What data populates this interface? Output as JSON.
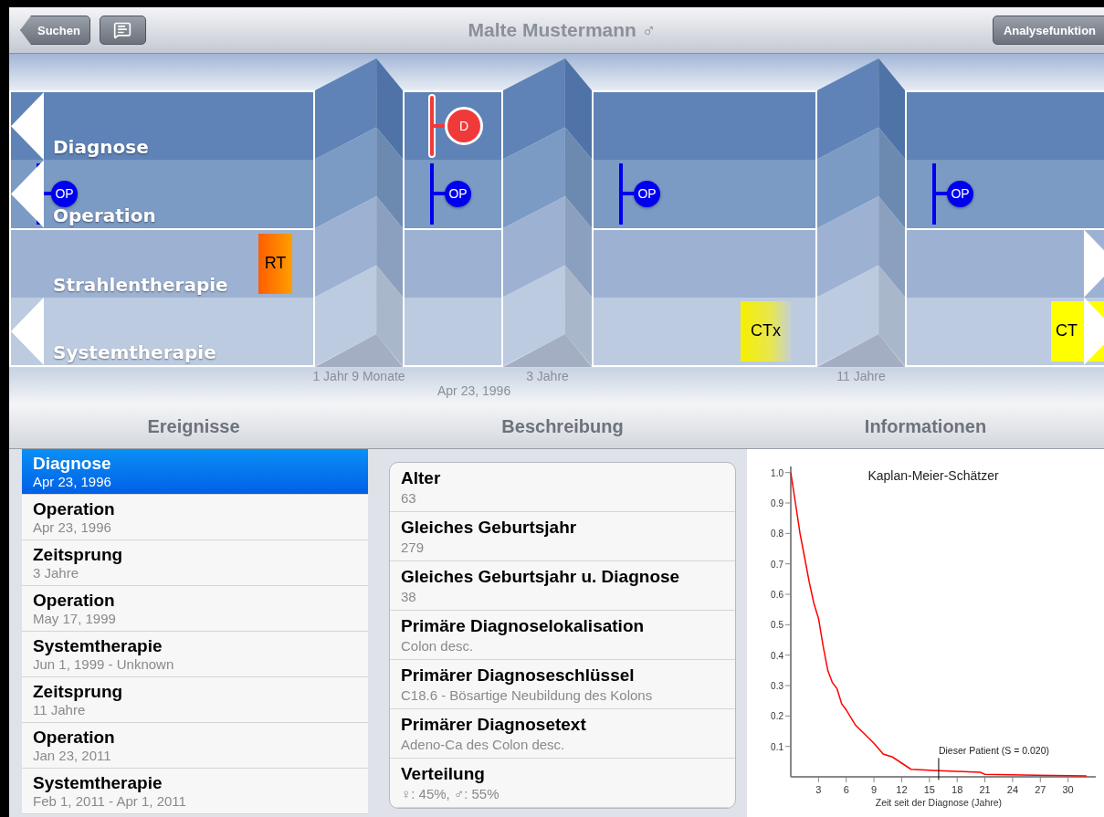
{
  "nav": {
    "back_button": "Suchen",
    "title": "Malte Mustermann ♂",
    "action_button": "Analysefunktion"
  },
  "timeline": {
    "lanes": [
      {
        "label": "Diagnose",
        "more_left": true,
        "more_right": false
      },
      {
        "label": "Operation",
        "more_left": true,
        "more_right": false
      },
      {
        "label": "Strahlentherapie",
        "more_left": false,
        "more_right": true
      },
      {
        "label": "Systemtherapie",
        "more_left": true,
        "more_right": true
      }
    ],
    "segments": [
      {
        "events": {
          "operation": [
            {
              "kind": "op",
              "label": "OP"
            }
          ],
          "radiation": [
            {
              "kind": "rt",
              "label": "RT"
            }
          ]
        }
      },
      {
        "events": {
          "diagnosis": [
            {
              "kind": "diagnosis",
              "label": "D"
            }
          ],
          "operation": [
            {
              "kind": "op",
              "label": "OP"
            }
          ]
        }
      },
      {
        "events": {
          "operation": [
            {
              "kind": "op",
              "label": "OP"
            }
          ],
          "systemic": [
            {
              "kind": "ctx",
              "label": "CTx"
            }
          ]
        }
      },
      {
        "events": {
          "operation": [
            {
              "kind": "op",
              "label": "OP"
            }
          ],
          "systemic": [
            {
              "kind": "ct",
              "label": "CT"
            }
          ]
        }
      }
    ],
    "gaps": [
      {
        "label": "1 Jahr 9 Monate"
      },
      {
        "label": "3 Jahre"
      },
      {
        "label": "11 Jahre"
      }
    ],
    "date": "Apr 23, 1996"
  },
  "sections": [
    "Ereignisse",
    "Beschreibung",
    "Informationen"
  ],
  "events": [
    {
      "title": "Diagnose",
      "subtitle": "Apr 23, 1996",
      "selected": true
    },
    {
      "title": "Operation",
      "subtitle": "Apr 23, 1996",
      "selected": false
    },
    {
      "title": "Zeitsprung",
      "subtitle": "3 Jahre",
      "selected": false
    },
    {
      "title": "Operation",
      "subtitle": "May 17, 1999",
      "selected": false
    },
    {
      "title": "Systemtherapie",
      "subtitle": "Jun 1, 1999 - Unknown",
      "selected": false
    },
    {
      "title": "Zeitsprung",
      "subtitle": "11 Jahre",
      "selected": false
    },
    {
      "title": "Operation",
      "subtitle": "Jan 23, 2011",
      "selected": false
    },
    {
      "title": "Systemtherapie",
      "subtitle": "Feb 1, 2011 - Apr 1, 2011",
      "selected": false
    }
  ],
  "description": [
    {
      "title": "Alter",
      "value": "63"
    },
    {
      "title": "Gleiches Geburtsjahr",
      "value": "279"
    },
    {
      "title": "Gleiches Geburtsjahr u. Diagnose",
      "value": "38"
    },
    {
      "title": "Primäre Diagnoselokalisation",
      "value": "Colon desc."
    },
    {
      "title": "Primärer Diagnoseschlüssel",
      "value": "C18.6 - Bösartige Neubildung des Kolons"
    },
    {
      "title": "Primärer Diagnosetext",
      "value": "Adeno-Ca des Colon desc."
    },
    {
      "title": "Verteilung",
      "value": "♀: 45%, ♂: 55%"
    }
  ],
  "information": {
    "chart_data": {
      "type": "line",
      "title": "Kaplan-Meier-Schätzer",
      "xlabel": "Zeit seit der Diagnose (Jahre)",
      "x": [
        0,
        0.5,
        1,
        1.5,
        2,
        2.5,
        3,
        3.5,
        4,
        4.5,
        5,
        5.5,
        6,
        7,
        8,
        9,
        10,
        11,
        12,
        13,
        16,
        20.5,
        21,
        26.5,
        32
      ],
      "series": [
        {
          "color": "#ff0000",
          "values": [
            1.0,
            0.9,
            0.8,
            0.72,
            0.64,
            0.57,
            0.52,
            0.43,
            0.35,
            0.31,
            0.29,
            0.24,
            0.22,
            0.17,
            0.14,
            0.11,
            0.075,
            0.065,
            0.045,
            0.025,
            0.02,
            0.015,
            0.008,
            0.005,
            0.003
          ]
        }
      ],
      "xlim": [
        0,
        33
      ],
      "ylim": [
        0,
        1.02
      ],
      "xticks": [
        3,
        6,
        9,
        12,
        15,
        18,
        21,
        24,
        27,
        30
      ],
      "yticks": [
        0.1,
        0.2,
        0.3,
        0.4,
        0.5,
        0.6,
        0.7,
        0.8,
        0.9,
        {
          "value": 1.0,
          "label": "1.0"
        }
      ],
      "annotations": [
        {
          "x": 16,
          "y": 0.02,
          "text": "Dieser Patient (S = 0.020)"
        }
      ]
    }
  }
}
